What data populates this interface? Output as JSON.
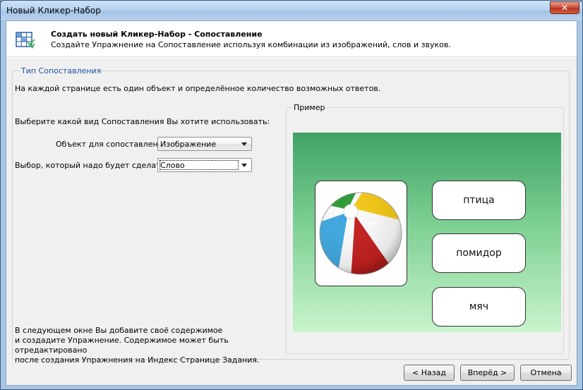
{
  "window": {
    "title": "Новый Кликер-Набор",
    "close_label": "✕"
  },
  "header": {
    "title": "Создать новый Кликер-Набор - Сопоставление",
    "subtitle": "Создайте Упражнение на Сопоставление используя комбинации из изображений, слов и звуков.",
    "icon": "grid-wizard-icon"
  },
  "group": {
    "legend": "Тип Сопоставления",
    "intro": "На каждой странице есть один объект и определённое количество возможных ответов.",
    "choose_prompt": "Выберите какой вид Сопоставления Вы хотите использовать:",
    "object_label": "Объект для сопоставления",
    "object_value": "Изображение",
    "choice_label": "Выбор, который надо будет сделать",
    "choice_value": "Слово",
    "bottom_lines": [
      "В следующем окне Вы добавите своё содержимое",
      "и создадите Упражнение. Содержимое может быть отредактировано",
      "после создания Упражнения на Индекс Странице Задания."
    ]
  },
  "sample": {
    "legend": "Пример",
    "image": "beach-ball-image",
    "words": [
      "птица",
      "помидор",
      "мяч"
    ]
  },
  "buttons": {
    "back": "< Назад",
    "next": "Вперёд >",
    "cancel": "Отмена"
  }
}
